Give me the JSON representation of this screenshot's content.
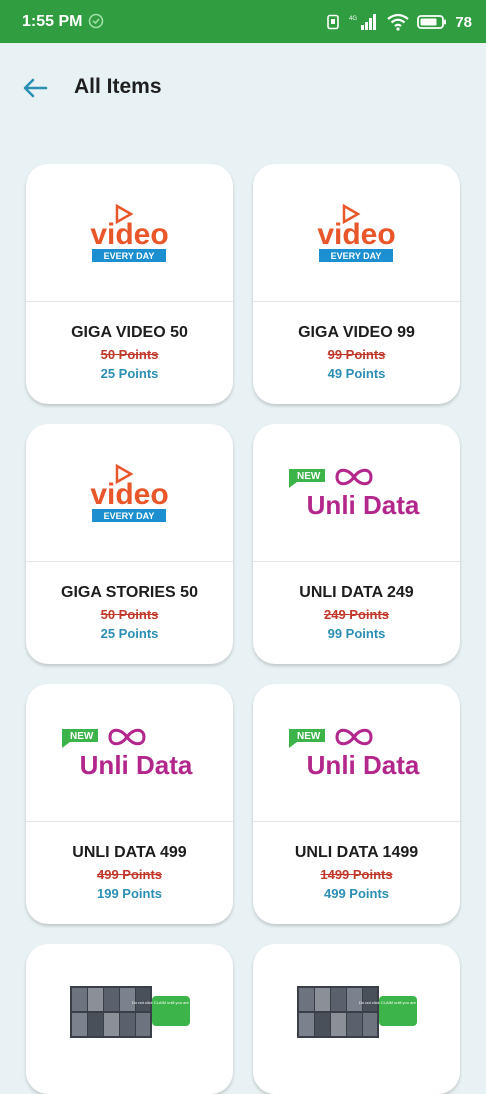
{
  "status_bar": {
    "time": "1:55 PM",
    "battery_percent": "78"
  },
  "header": {
    "title": "All Items"
  },
  "items": [
    {
      "name": "GIGA VIDEO 50",
      "old_points": "50 Points",
      "new_points": "25 Points",
      "logo": "video-everyday"
    },
    {
      "name": "GIGA VIDEO 99",
      "old_points": "99 Points",
      "new_points": "49 Points",
      "logo": "video-everyday"
    },
    {
      "name": "GIGA STORIES 50",
      "old_points": "50 Points",
      "new_points": "25 Points",
      "logo": "video-everyday"
    },
    {
      "name": "UNLI DATA 249",
      "old_points": "249 Points",
      "new_points": "99 Points",
      "logo": "unli-data"
    },
    {
      "name": "UNLI DATA 499",
      "old_points": "499 Points",
      "new_points": "199 Points",
      "logo": "unli-data"
    },
    {
      "name": "UNLI DATA 1499",
      "old_points": "1499 Points",
      "new_points": "499 Points",
      "logo": "unli-data"
    },
    {
      "logo": "promo-photos"
    },
    {
      "logo": "promo-photos"
    }
  ],
  "logos": {
    "video_word": "video",
    "video_sub": "EVERY DAY",
    "unli_badge": "NEW",
    "unli_word": "Unli Data",
    "promo_note": "Do not click CLAIM until you are at the store"
  },
  "colors": {
    "status_green": "#2f9d40",
    "accent_blue": "#2b8fb3",
    "strike_red": "#c0392b",
    "unli_magenta": "#b3268b",
    "video_orange": "#e8562a"
  }
}
